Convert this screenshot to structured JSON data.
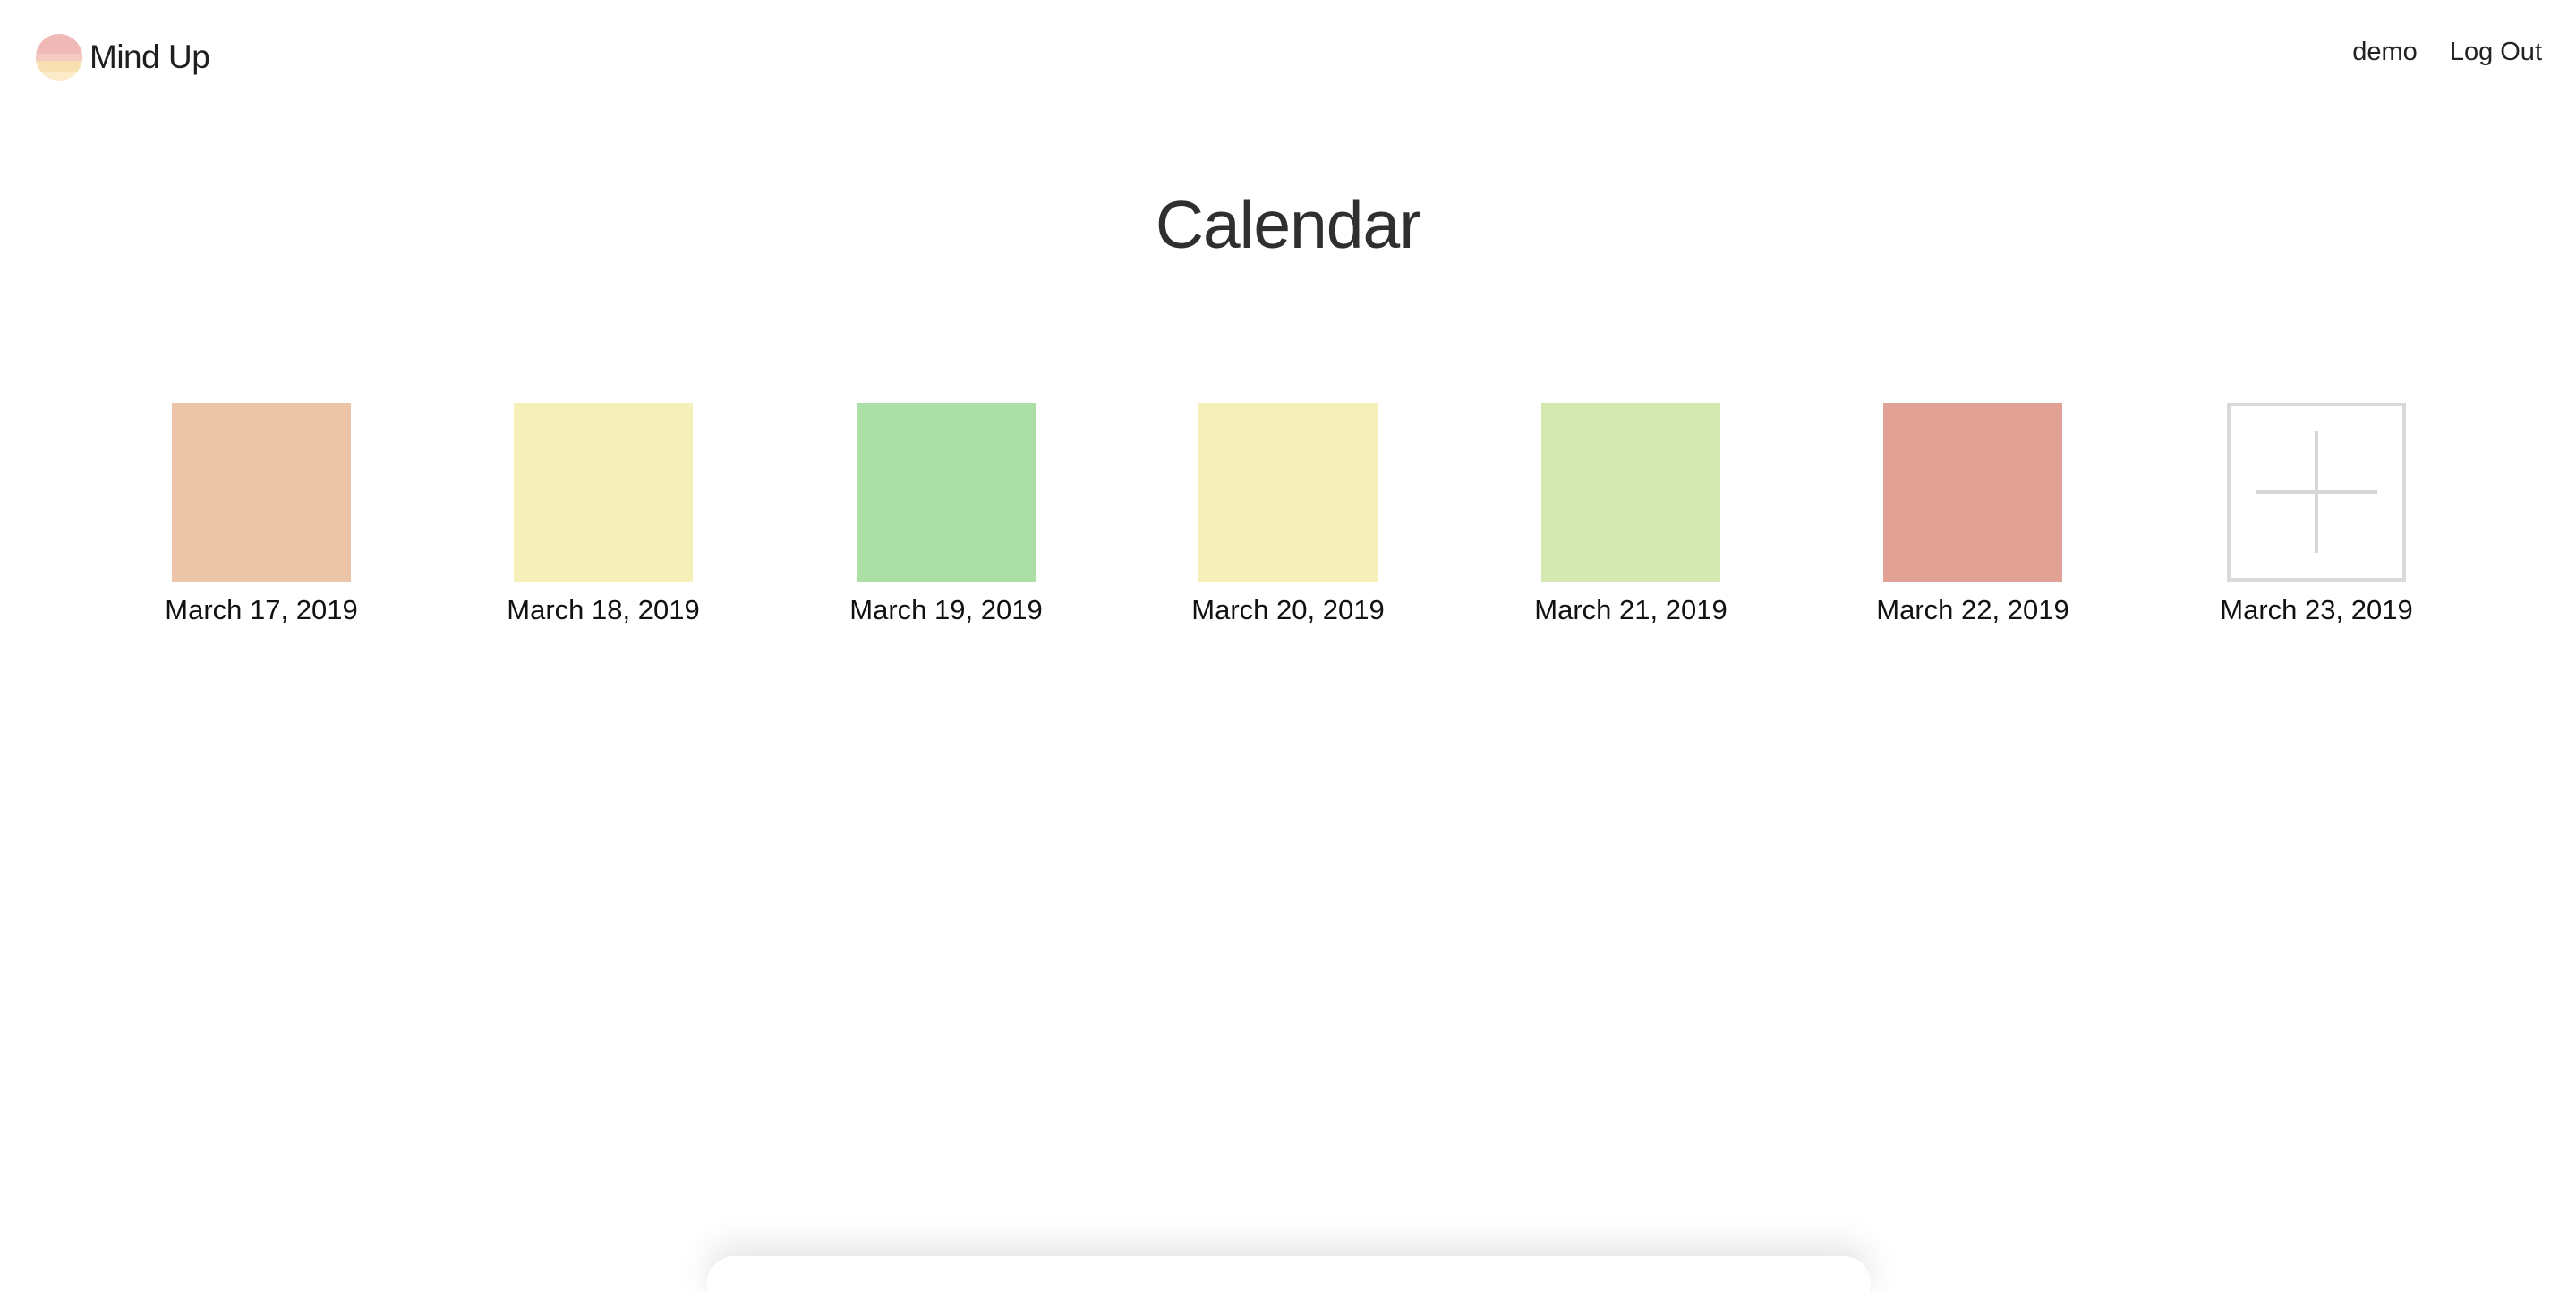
{
  "header": {
    "brand_name": "Mind Up",
    "logo_colors": [
      "#f0b8b6",
      "#f3c9c0",
      "#f8dfb2",
      "#fbebc8"
    ],
    "user_label": "demo",
    "logout_label": "Log Out"
  },
  "main": {
    "title": "Calendar",
    "days": [
      {
        "label": "March 17, 2019",
        "color": "#ecc4a7",
        "status": "logged"
      },
      {
        "label": "March 18, 2019",
        "color": "#f5f0b9",
        "status": "logged"
      },
      {
        "label": "March 19, 2019",
        "color": "#acdfa6",
        "status": "logged"
      },
      {
        "label": "March 20, 2019",
        "color": "#f5f0b9",
        "status": "logged"
      },
      {
        "label": "March 21, 2019",
        "color": "#d6e8b2",
        "status": "logged"
      },
      {
        "label": "March 22, 2019",
        "color": "#e1a195",
        "status": "logged"
      },
      {
        "label": "March 23, 2019",
        "color": "#ffffff",
        "status": "add",
        "icon": "plus-icon"
      }
    ]
  }
}
